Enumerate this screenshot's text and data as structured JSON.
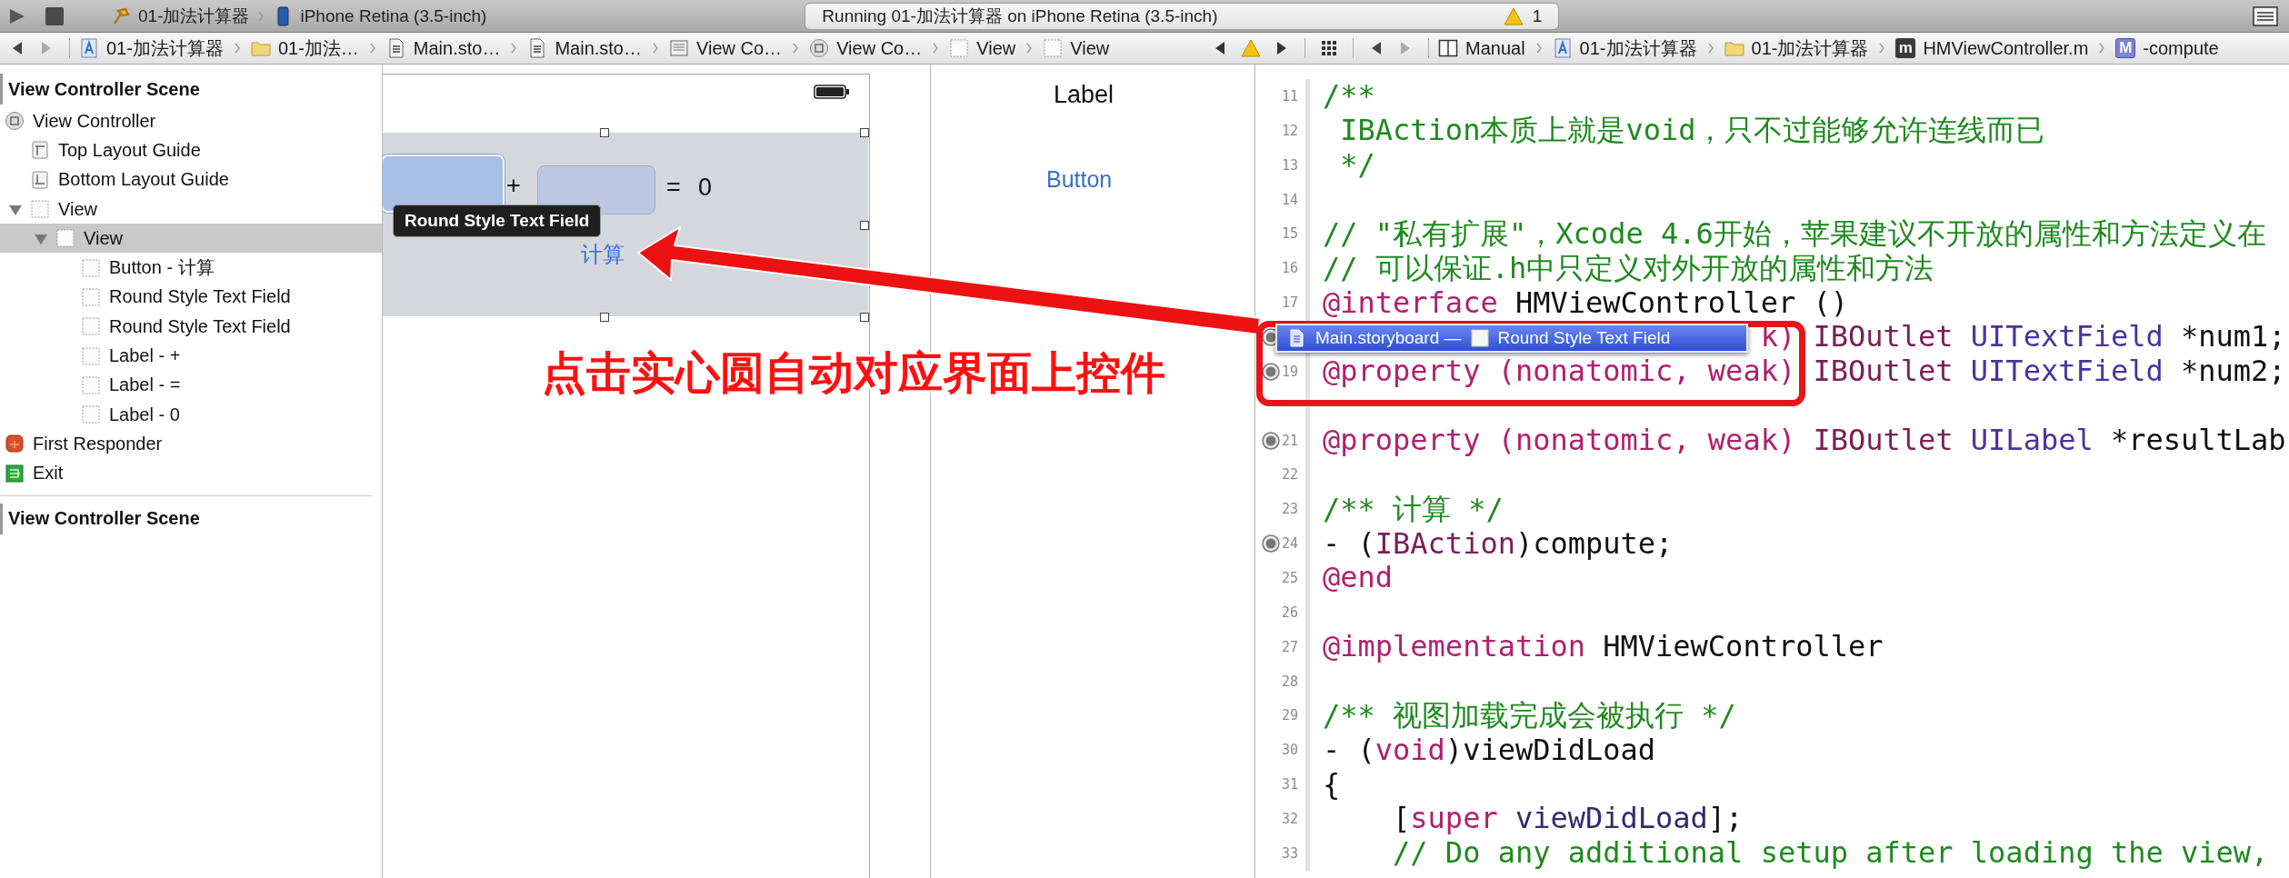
{
  "title_bar": {
    "scheme": "01-加法计算器",
    "destination": "iPhone Retina (3.5-inch)",
    "status": "Running 01-加法计算器 on iPhone Retina (3.5-inch)",
    "warning_count": "1"
  },
  "jump_bar": {
    "left": [
      {
        "kind": "project",
        "label": "01-加法计算器"
      },
      {
        "kind": "folder",
        "label": "01-加法…"
      },
      {
        "kind": "storyboard",
        "label": "Main.sto…"
      },
      {
        "kind": "storyboard",
        "label": "Main.sto…"
      },
      {
        "kind": "scene",
        "label": "View Co…"
      },
      {
        "kind": "controller",
        "label": "View Co…"
      },
      {
        "kind": "view",
        "label": "View"
      },
      {
        "kind": "view",
        "label": "View"
      }
    ],
    "right": [
      {
        "kind": "manual",
        "label": "Manual"
      },
      {
        "kind": "project",
        "label": "01-加法计算器"
      },
      {
        "kind": "folder",
        "label": "01-加法计算器"
      },
      {
        "kind": "source",
        "badge": "m",
        "label": "HMViewController.m"
      },
      {
        "kind": "method",
        "badge": "M",
        "label": "-compute"
      }
    ]
  },
  "outline": {
    "header": "View Controller Scene",
    "items": [
      {
        "kind": "controller",
        "label": "View Controller",
        "selected": false,
        "children": [
          {
            "kind": "top-guide",
            "label": "Top Layout Guide",
            "selected": false
          },
          {
            "kind": "bottom-guide",
            "label": "Bottom Layout Guide",
            "selected": false
          },
          {
            "kind": "view",
            "label": "View",
            "selected": false,
            "expanded": true,
            "children": [
              {
                "kind": "view",
                "label": "View",
                "selected": true,
                "expanded": true,
                "children": [
                  {
                    "kind": "view",
                    "label": "Button - 计算",
                    "selected": false
                  },
                  {
                    "kind": "view",
                    "label": "Round Style Text Field",
                    "selected": false
                  },
                  {
                    "kind": "view",
                    "label": "Round Style Text Field",
                    "selected": false
                  },
                  {
                    "kind": "view",
                    "label": "Label - +",
                    "selected": false
                  },
                  {
                    "kind": "view",
                    "label": "Label - =",
                    "selected": false
                  },
                  {
                    "kind": "view",
                    "label": "Label - 0",
                    "selected": false
                  }
                ]
              }
            ]
          }
        ]
      },
      {
        "kind": "responder",
        "label": "First Responder",
        "selected": false
      },
      {
        "kind": "exit",
        "label": "Exit",
        "selected": false
      }
    ],
    "footer_header": "View Controller Scene"
  },
  "canvas": {
    "scene_1": {
      "text_fields": [
        {
          "selected": true
        },
        {
          "selected": false
        }
      ],
      "plus_label": "+",
      "equals_label": "=",
      "result_label": "0",
      "compute_button": "计算",
      "tooltip": "Round Style Text Field"
    },
    "scene_2": {
      "label": "Label",
      "button": "Button"
    }
  },
  "editor": {
    "lines": [
      {
        "kind": "code",
        "number": "11",
        "connected": false,
        "segments": [
          {
            "kind": "comment",
            "text": "/**"
          }
        ]
      },
      {
        "kind": "code",
        "number": "12",
        "connected": false,
        "segments": [
          {
            "kind": "comment",
            "text": " IBAction本质上就是void，只不过能够允许连线而已"
          }
        ]
      },
      {
        "kind": "code",
        "number": "13",
        "connected": false,
        "segments": [
          {
            "kind": "comment",
            "text": " */"
          }
        ]
      },
      {
        "kind": "code",
        "number": "14",
        "connected": false
      },
      {
        "kind": "code",
        "number": "15",
        "connected": false,
        "segments": [
          {
            "kind": "comment",
            "text": "// \"私有扩展\"，Xcode 4.6开始，苹果建议不开放的属性和方法定义在"
          }
        ]
      },
      {
        "kind": "code",
        "number": "16",
        "connected": false,
        "segments": [
          {
            "kind": "comment",
            "text": "// 可以保证.h中只定义对外开放的属性和方法"
          }
        ]
      },
      {
        "kind": "code",
        "number": "17",
        "connected": false,
        "segments": [
          {
            "kind": "keyword",
            "text": "@interface"
          },
          {
            "kind": "plain",
            "text": " HMViewController ()"
          }
        ]
      },
      {
        "kind": "covered",
        "connected": true,
        "segments": [
          {
            "kind": "keyword",
            "text": "k)"
          },
          {
            "kind": "macro",
            "text": " IBOutlet"
          },
          {
            "kind": "type",
            "text": " UITextField"
          },
          {
            "kind": "plain",
            "text": " *num1;"
          }
        ]
      },
      {
        "kind": "code",
        "number": "19",
        "connected": true,
        "segments": [
          {
            "kind": "keyword",
            "text": "@property (nonatomic, weak)"
          },
          {
            "kind": "macro",
            "text": " IBOutlet"
          },
          {
            "kind": "type",
            "text": " UITextField"
          },
          {
            "kind": "plain",
            "text": " *num2;"
          }
        ]
      },
      {
        "kind": "code",
        "connected": false
      },
      {
        "kind": "code",
        "number": "21",
        "connected": true,
        "segments": [
          {
            "kind": "keyword",
            "text": "@property (nonatomic, weak)"
          },
          {
            "kind": "macro",
            "text": " IBOutlet"
          },
          {
            "kind": "type",
            "text": " UILabel"
          },
          {
            "kind": "plain",
            "text": " *resultLab"
          }
        ]
      },
      {
        "kind": "code",
        "number": "22",
        "connected": false
      },
      {
        "kind": "code",
        "number": "23",
        "connected": false,
        "segments": [
          {
            "kind": "comment",
            "text": "/** 计算 */"
          }
        ]
      },
      {
        "kind": "code",
        "number": "24",
        "connected": true,
        "segments": [
          {
            "kind": "plain",
            "text": "- ("
          },
          {
            "kind": "macro",
            "text": "IBAction"
          },
          {
            "kind": "plain",
            "text": ")compute;"
          }
        ]
      },
      {
        "kind": "code",
        "number": "25",
        "connected": false,
        "segments": [
          {
            "kind": "keyword",
            "text": "@end"
          }
        ]
      },
      {
        "kind": "code",
        "number": "26",
        "connected": false
      },
      {
        "kind": "code",
        "number": "27",
        "connected": false,
        "segments": [
          {
            "kind": "keyword",
            "text": "@implementation"
          },
          {
            "kind": "plain",
            "text": " HMViewController"
          }
        ]
      },
      {
        "kind": "code",
        "number": "28",
        "connected": false
      },
      {
        "kind": "code",
        "number": "29",
        "connected": false,
        "segments": [
          {
            "kind": "comment",
            "text": "/** 视图加载完成会被执行 */"
          }
        ]
      },
      {
        "kind": "code",
        "number": "30",
        "connected": false,
        "segments": [
          {
            "kind": "plain",
            "text": "- ("
          },
          {
            "kind": "keyword",
            "text": "void"
          },
          {
            "kind": "plain",
            "text": ")viewDidLoad"
          }
        ]
      },
      {
        "kind": "code",
        "number": "31",
        "connected": false,
        "segments": [
          {
            "kind": "plain",
            "text": "{"
          }
        ]
      },
      {
        "kind": "code",
        "number": "32",
        "connected": false,
        "segments": [
          {
            "kind": "plain",
            "text": "    ["
          },
          {
            "kind": "keyword",
            "text": "super"
          },
          {
            "kind": "method",
            "text": " viewDidLoad"
          },
          {
            "kind": "plain",
            "text": "];"
          }
        ]
      },
      {
        "kind": "indented",
        "number": "33",
        "connected": false,
        "segments": [
          {
            "kind": "comment",
            "text": "// Do any additional setup after loading the view,"
          }
        ]
      }
    ]
  },
  "overlay": {
    "connection_popup": {
      "file": "Main.storyboard —",
      "object": "Round Style Text Field"
    },
    "annotation": {
      "caption": "点击实心圆自动对应界面上控件"
    }
  }
}
